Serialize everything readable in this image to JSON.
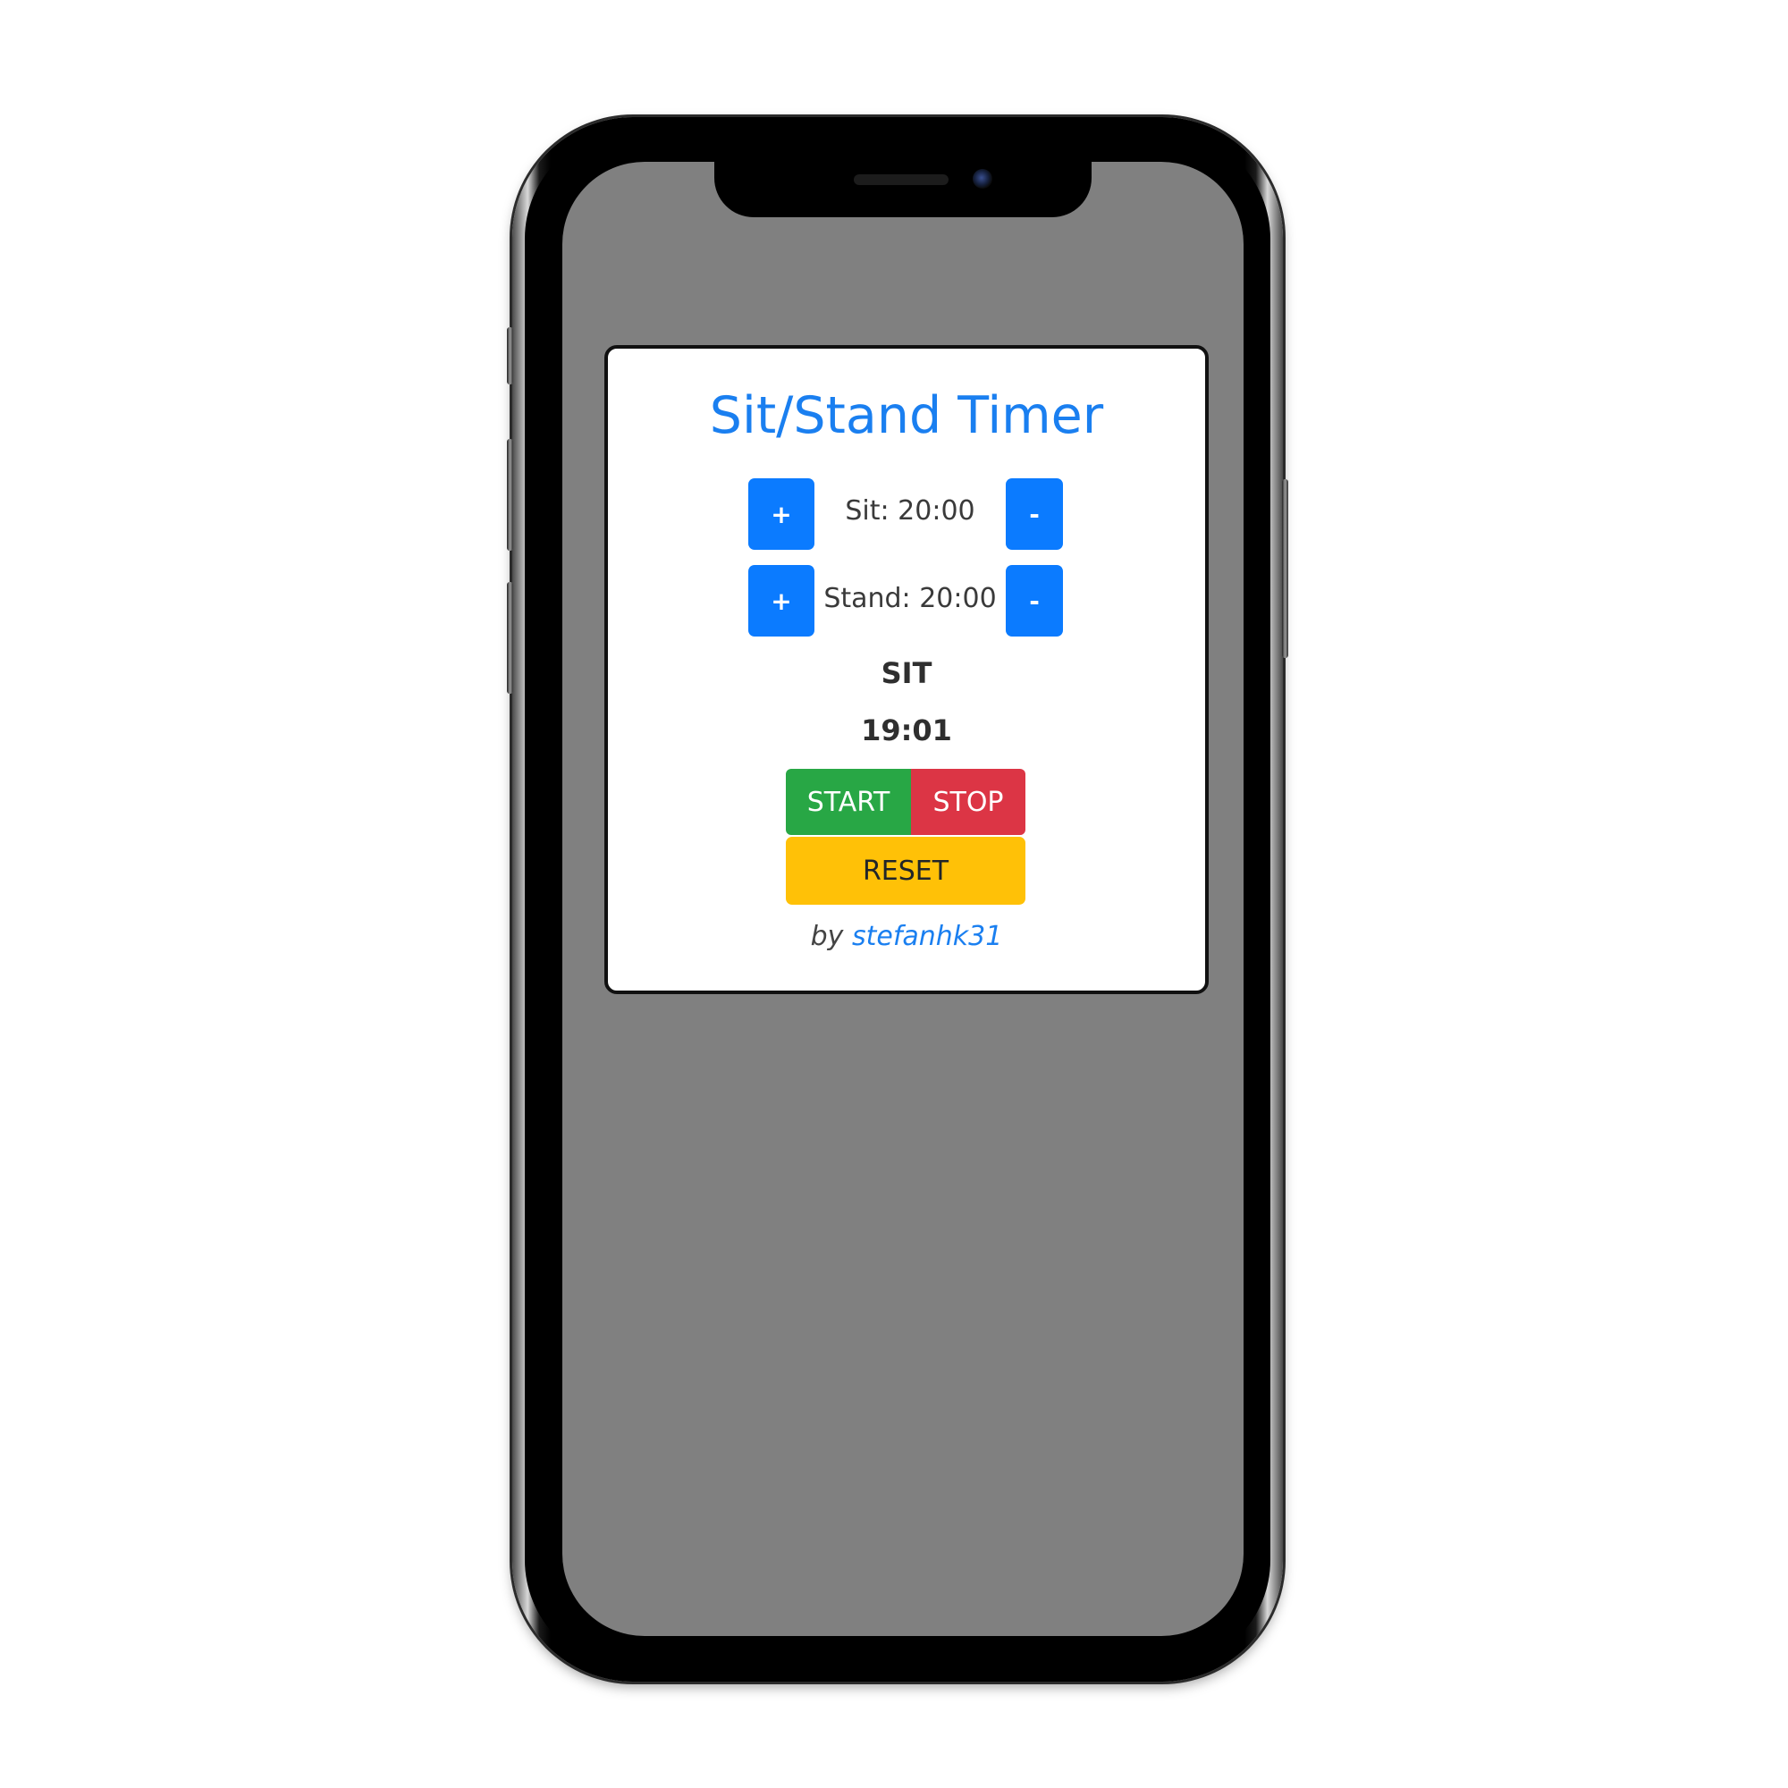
{
  "app": {
    "title": "Sit/Stand Timer"
  },
  "settings": {
    "sit": {
      "label": "Sit: 20:00",
      "plus_label": "+",
      "minus_label": "-"
    },
    "stand": {
      "label": "Stand: 20:00",
      "plus_label": "+",
      "minus_label": "-"
    }
  },
  "status": {
    "mode": "SIT",
    "time": "19:01"
  },
  "controls": {
    "start_label": "START",
    "stop_label": "STOP",
    "reset_label": "RESET"
  },
  "credit": {
    "prefix": "by",
    "author": "stefanhk31"
  },
  "colors": {
    "primary": "#0b7bff",
    "title": "#1a7ff0",
    "start": "#28a745",
    "stop": "#dc3545",
    "reset": "#ffc107",
    "screen_background": "#808080"
  }
}
